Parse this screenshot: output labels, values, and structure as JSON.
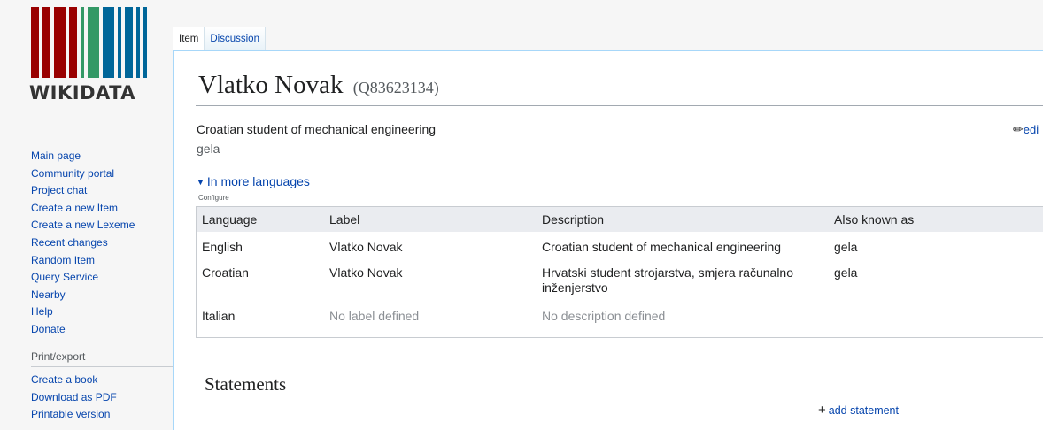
{
  "logo": {
    "wordmark": "WIKIDATA",
    "colors": {
      "red": "#990000",
      "green": "#339966",
      "blue": "#006699"
    }
  },
  "sidebar": {
    "nav_items": [
      "Main page",
      "Community portal",
      "Project chat",
      "Create a new Item",
      "Create a new Lexeme",
      "Recent changes",
      "Random Item",
      "Query Service",
      "Nearby",
      "Help",
      "Donate"
    ],
    "print_heading": "Print/export",
    "print_items": [
      "Create a book",
      "Download as PDF",
      "Printable version"
    ]
  },
  "tabs": [
    {
      "label": "Item",
      "selected": true
    },
    {
      "label": "Discussion",
      "selected": false
    }
  ],
  "item": {
    "label": "Vlatko Novak",
    "qid": "(Q83623134)",
    "description": "Croatian student of mechanical engineering",
    "alias": "gela",
    "edit_label": "edi"
  },
  "in_more_languages": {
    "toggle_label": "In more languages",
    "configure_label": "Configure",
    "headers": [
      "Language",
      "Label",
      "Description",
      "Also known as"
    ],
    "rows": [
      {
        "language": "English",
        "label": "Vlatko Novak",
        "description": "Croatian student of mechanical engineering",
        "aliases": "gela"
      },
      {
        "language": "Croatian",
        "label": "Vlatko Novak",
        "description": "Hrvatski student strojarstva, smjera računalno inženjerstvo",
        "aliases": "gela"
      },
      {
        "language": "Italian",
        "label": "No label defined",
        "description": "No description defined",
        "aliases": ""
      }
    ]
  },
  "statements": {
    "heading": "Statements",
    "add_label": "add statement"
  }
}
